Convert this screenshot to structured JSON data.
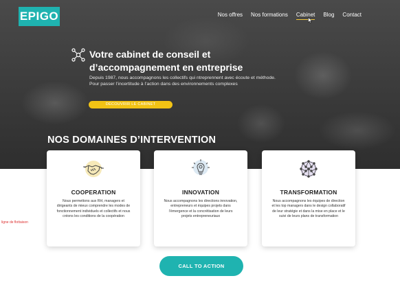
{
  "header": {
    "logo_text": "EPIGO",
    "nav": [
      "Nos offres",
      "Nos formations",
      "Cabinet",
      "Blog",
      "Contact"
    ],
    "active_nav": "Cabinet"
  },
  "hero": {
    "icon": "network-nodes-icon",
    "title_line1": "Votre cabinet de conseil et",
    "title_line2": "d’accompagnement en entreprise",
    "text": "Depuis 1987, nous accompagnons les collectifs qui ntreprennent avec écoute et méthode. Pour passer l’incertitude à l’action dans des environnements complexes",
    "button": "DÉCOUVRIR LE CABINET"
  },
  "section": {
    "title": "NOS DOMAINES D’INTERVENTION",
    "side_note": "ligne de flottaison"
  },
  "cards": [
    {
      "icon": "handshake-icon",
      "title": "COOPERATION",
      "text": "Nous permettons aux RH, managers et dirigeants de mieux comprendre les modes de fonctionnement individuels et collectifs et nous créons les conditions de la coopération"
    },
    {
      "icon": "lightbulb-gear-icon",
      "title": "INNOVATION",
      "text": "Nous accompagnons les directions innovation, entrepreneurs et équipes projets dans l’émergence et la concrétisation de leurs projets entrepreneuriaux"
    },
    {
      "icon": "network-globe-icon",
      "title": "TRANSFORMATION",
      "text": "Nous accompagnons les équipes de direction et les top managers dans le design collaboratif de leur stratégie et dans la mise en place et le suivi de leurs plans de transformation"
    }
  ],
  "cta": {
    "label": "CALL TO ACTION"
  },
  "colors": {
    "brand": "#1fb3b0",
    "accent": "#f2c315",
    "nav_underline": "#f3c83a"
  }
}
